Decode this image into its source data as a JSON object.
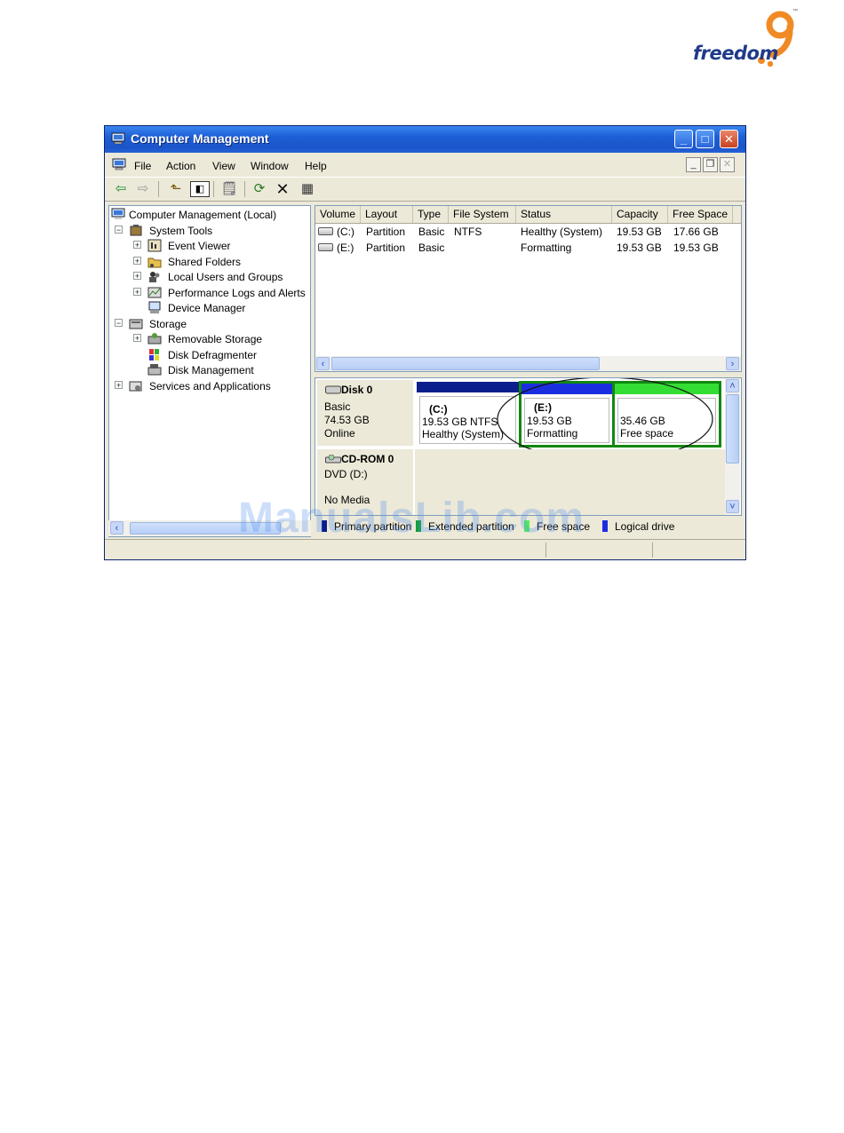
{
  "logo": {
    "text": "freedom",
    "mark": "9",
    "tm": "™"
  },
  "window": {
    "title": "Computer Management",
    "menu": [
      "File",
      "Action",
      "View",
      "Window",
      "Help"
    ]
  },
  "tree": {
    "root": "Computer Management (Local)",
    "items": [
      {
        "label": "System Tools",
        "icon": "tools-icon"
      },
      {
        "label": "Event Viewer",
        "icon": "event-viewer-icon"
      },
      {
        "label": "Shared Folders",
        "icon": "shared-folders-icon"
      },
      {
        "label": "Local Users and Groups",
        "icon": "users-icon"
      },
      {
        "label": "Performance Logs and Alerts",
        "icon": "performance-icon"
      },
      {
        "label": "Device Manager",
        "icon": "device-manager-icon"
      },
      {
        "label": "Storage",
        "icon": "storage-icon"
      },
      {
        "label": "Removable Storage",
        "icon": "removable-storage-icon"
      },
      {
        "label": "Disk Defragmenter",
        "icon": "defrag-icon"
      },
      {
        "label": "Disk Management",
        "icon": "disk-management-icon"
      },
      {
        "label": "Services and Applications",
        "icon": "services-icon"
      }
    ]
  },
  "list": {
    "columns": [
      "Volume",
      "Layout",
      "Type",
      "File System",
      "Status",
      "Capacity",
      "Free Space"
    ],
    "rows": [
      [
        "(C:)",
        "Partition",
        "Basic",
        "NTFS",
        "Healthy (System)",
        "19.53 GB",
        "17.66 GB"
      ],
      [
        "(E:)",
        "Partition",
        "Basic",
        "",
        "Formatting",
        "19.53 GB",
        "19.53 GB"
      ]
    ]
  },
  "disks": {
    "disk0": {
      "name": "Disk 0",
      "type": "Basic",
      "size": "74.53 GB",
      "state": "Online"
    },
    "cdrom0": {
      "name": "CD-ROM 0",
      "type": "DVD (D:)",
      "state": "No Media"
    },
    "volumes": [
      {
        "label": "(C:)",
        "size": "19.53 GB NTFS",
        "status": "Healthy (System)",
        "color": "#0a1e8c"
      },
      {
        "label": "(E:)",
        "size": "19.53 GB",
        "status": "Formatting",
        "color": "#1a2ee0"
      },
      {
        "label": "",
        "size": "35.46 GB",
        "status": "Free space",
        "color": "#33dd33"
      }
    ]
  },
  "legend": [
    {
      "label": "Primary partition",
      "color": "#0a1e8c"
    },
    {
      "label": "Extended partition",
      "color": "#10a030"
    },
    {
      "label": "Free space",
      "color": "#55ee55"
    },
    {
      "label": "Logical drive",
      "color": "#1a2ee0"
    }
  ],
  "watermark": "ManualsLib.com"
}
